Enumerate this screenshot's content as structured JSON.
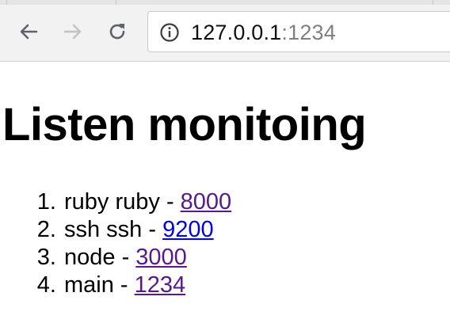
{
  "browser": {
    "url_host": "127.0.0.1",
    "url_port": ":1234",
    "back_icon": "arrow-left-icon",
    "forward_icon": "arrow-right-icon",
    "reload_icon": "reload-icon",
    "site_info_icon": "info-circle-icon"
  },
  "page": {
    "title": "Listen monitoing",
    "items": [
      {
        "name": "ruby ruby",
        "sep": " - ",
        "port": "8000",
        "visited": true
      },
      {
        "name": "ssh ssh",
        "sep": " - ",
        "port": "9200",
        "visited": false
      },
      {
        "name": "node",
        "sep": " - ",
        "port": "3000",
        "visited": true
      },
      {
        "name": "main",
        "sep": " - ",
        "port": "1234",
        "visited": true
      }
    ]
  },
  "colors": {
    "visited_link": "#551a8b",
    "unvisited_link": "#0000ee",
    "toolbar_bg": "#f2f2f2"
  }
}
